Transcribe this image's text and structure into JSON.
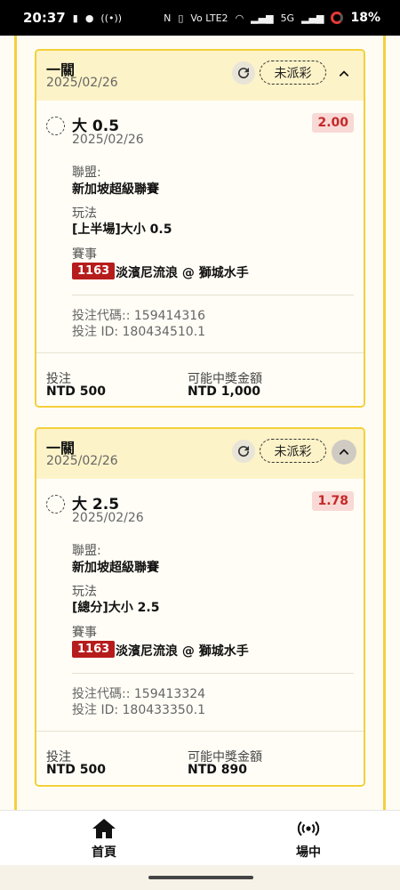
{
  "status_bar": {
    "time": "20:37",
    "network": "5G",
    "volte": "Vo LTE2",
    "battery": "18%"
  },
  "bets": [
    {
      "title": "一關",
      "date": "2025/02/26",
      "status": "未派彩",
      "selection": "大 0.5",
      "selection_date": "2025/02/26",
      "odds": "2.00",
      "league_label": "聯盟:",
      "league": "新加坡超級聯賽",
      "play_label": "玩法",
      "play": "[上半場]大小 0.5",
      "match_label": "賽事",
      "match_number": "1163",
      "match_name": "淡濱尼流浪 @ 獅城水手",
      "bet_code": "投注代碼:: 159414316",
      "bet_id": "投注 ID: 180434510.1",
      "stake_label": "投注",
      "stake": "NTD 500",
      "payout_label": "可能中獎金額",
      "payout": "NTD 1,000"
    },
    {
      "title": "一關",
      "date": "2025/02/26",
      "status": "未派彩",
      "selection": "大 2.5",
      "selection_date": "2025/02/26",
      "odds": "1.78",
      "league_label": "聯盟:",
      "league": "新加坡超級聯賽",
      "play_label": "玩法",
      "play": "[總分]大小 2.5",
      "match_label": "賽事",
      "match_number": "1163",
      "match_name": "淡濱尼流浪 @ 獅城水手",
      "bet_code": "投注代碼:: 159413324",
      "bet_id": "投注 ID: 180433350.1",
      "stake_label": "投注",
      "stake": "NTD 500",
      "payout_label": "可能中獎金額",
      "payout": "NTD 890"
    }
  ],
  "nav": {
    "home_label": "首頁",
    "live_label": "場中"
  },
  "colors": {
    "accent_yellow": "#f3cf3a",
    "header_bg": "#fdf3c8",
    "odds_red": "#c62828",
    "match_badge": "#b71c1c"
  }
}
